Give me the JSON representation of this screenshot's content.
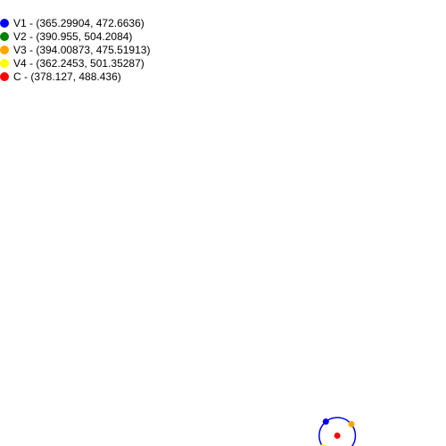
{
  "legend": [
    {
      "label": "V1 - (365.29904, 472.6636)",
      "color": "#0000ff"
    },
    {
      "label": "V2 - (390.955, 504.2084)",
      "color": "#008000"
    },
    {
      "label": "V3 - (394.00873, 475.51913)",
      "color": "#ffa500"
    },
    {
      "label": "V4 - (362.2453, 501.35287)",
      "color": "#ffff00"
    },
    {
      "label": "C - (378.127, 488.436)",
      "color": "#ff0000"
    }
  ],
  "points": [
    {
      "name": "V1",
      "x": 365.29904,
      "y": 472.6636,
      "color": "#0000ff"
    },
    {
      "name": "V2",
      "x": 390.955,
      "y": 504.2084,
      "color": "#008000"
    },
    {
      "name": "V3",
      "x": 394.00873,
      "y": 475.51913,
      "color": "#ffa500"
    },
    {
      "name": "V4",
      "x": 362.2453,
      "y": 501.35287,
      "color": "#ffff00"
    },
    {
      "name": "C",
      "x": 378.127,
      "y": 488.436,
      "color": "#ff0000"
    }
  ],
  "circle": {
    "center": "C",
    "through": "V1",
    "color": "#0000ff"
  }
}
